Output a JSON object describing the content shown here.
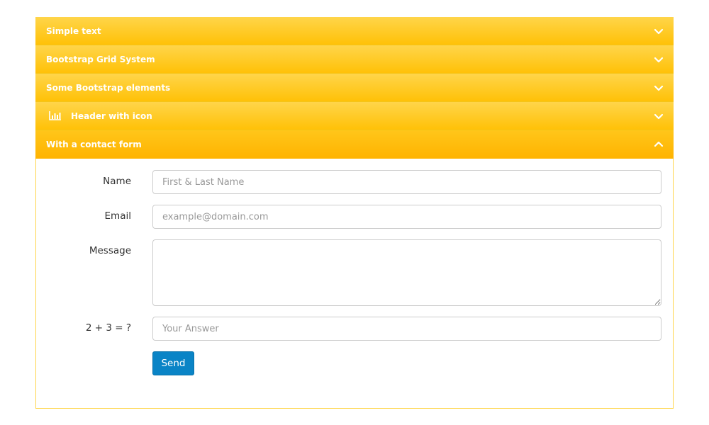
{
  "colors": {
    "header_gradient_top": "#ffd54a",
    "header_gradient_bottom": "#ffc107",
    "button": "#0a84c6"
  },
  "accordion": {
    "panels": [
      {
        "title": "Simple text",
        "state": "collapsed",
        "chevron_icon": "chevron-down-icon"
      },
      {
        "title": "Bootstrap Grid System",
        "state": "collapsed",
        "chevron_icon": "chevron-down-icon"
      },
      {
        "title": "Some Bootstrap elements",
        "state": "collapsed",
        "chevron_icon": "chevron-down-icon"
      },
      {
        "title": "Header with icon",
        "state": "collapsed",
        "icon": "bar-chart-icon",
        "chevron_icon": "chevron-down-icon"
      },
      {
        "title": "With a contact form",
        "state": "expanded",
        "chevron_icon": "chevron-up-icon"
      }
    ]
  },
  "contact_form": {
    "name": {
      "label": "Name",
      "value": "",
      "placeholder": "First & Last Name"
    },
    "email": {
      "label": "Email",
      "value": "",
      "placeholder": "example@domain.com"
    },
    "message": {
      "label": "Message",
      "value": "",
      "placeholder": ""
    },
    "captcha": {
      "label": "2 + 3 = ?",
      "value": "",
      "placeholder": "Your Answer"
    },
    "send_label": "Send"
  }
}
